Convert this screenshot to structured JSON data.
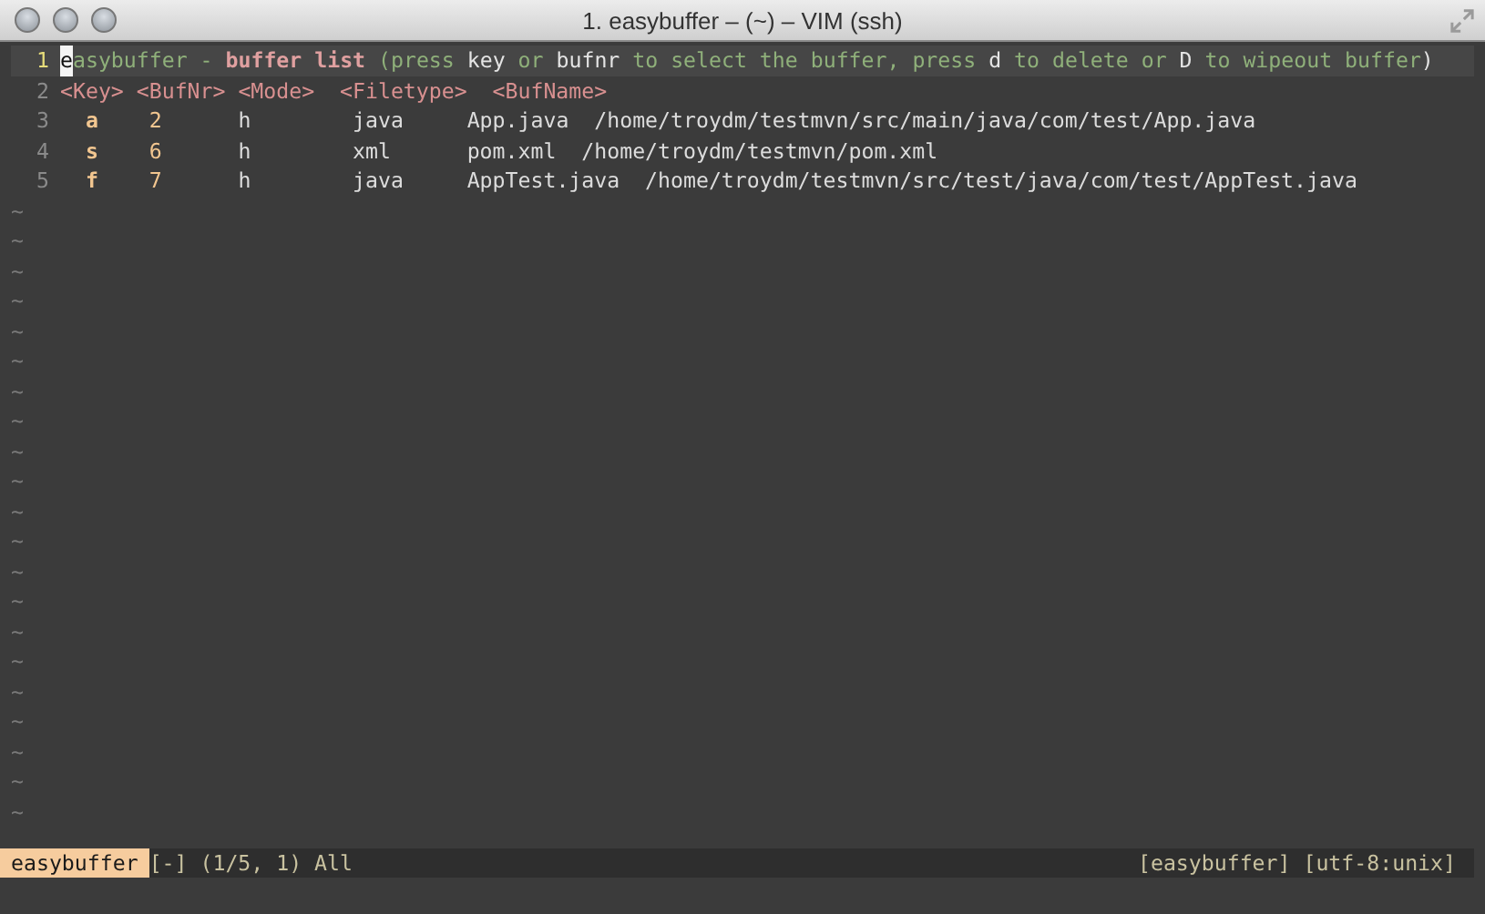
{
  "window": {
    "title": "1. easybuffer – (~) – VIM (ssh)"
  },
  "lines": [
    {
      "number": "1",
      "current": true,
      "kind": "text",
      "segments": [
        {
          "kind": "cursor",
          "text": "e"
        },
        {
          "kind": "title",
          "text": "asybuffer - "
        },
        {
          "kind": "keyword",
          "text": "buffer list"
        },
        {
          "kind": "hint",
          "text": " (press "
        },
        {
          "kind": "plain",
          "text": "key"
        },
        {
          "kind": "hint",
          "text": " or "
        },
        {
          "kind": "plain",
          "text": "bufnr"
        },
        {
          "kind": "hint",
          "text": " to select the buffer, press "
        },
        {
          "kind": "plain",
          "text": "d"
        },
        {
          "kind": "hint",
          "text": " to delete or "
        },
        {
          "kind": "plain",
          "text": "D"
        },
        {
          "kind": "hint",
          "text": " to wipeout buffer"
        },
        {
          "kind": "plain",
          "text": ")"
        }
      ]
    },
    {
      "number": "2",
      "current": false,
      "kind": "header",
      "columns": [
        "<Key>",
        "<BufNr>",
        "<Mode>",
        "<Filetype>",
        "<BufName>"
      ]
    },
    {
      "number": "3",
      "current": false,
      "kind": "buffer",
      "key": "a",
      "bufnr": "2",
      "mode": "h",
      "filetype": "java",
      "name": "App.java",
      "path": "/home/troydm/testmvn/src/main/java/com/test/App.java"
    },
    {
      "number": "4",
      "current": false,
      "kind": "buffer",
      "key": "s",
      "bufnr": "6",
      "mode": "h",
      "filetype": "xml",
      "name": "pom.xml",
      "path": "/home/troydm/testmvn/pom.xml"
    },
    {
      "number": "5",
      "current": false,
      "kind": "buffer",
      "key": "f",
      "bufnr": "7",
      "mode": "h",
      "filetype": "java",
      "name": "AppTest.java",
      "path": "/home/troydm/testmvn/src/test/java/com/test/AppTest.java"
    }
  ],
  "tildes": [
    "~",
    "~",
    "~",
    "~",
    "~",
    "~",
    "~",
    "~",
    "~",
    "~",
    "~",
    "~",
    "~",
    "~",
    "~",
    "~",
    "~",
    "~",
    "~",
    "~",
    "~"
  ],
  "status_bar": {
    "buffer_name": "easybuffer",
    "flags": "[-]",
    "position": "(1/5, 1) All",
    "file_info": "[easybuffer] [utf-8:unix]"
  }
}
